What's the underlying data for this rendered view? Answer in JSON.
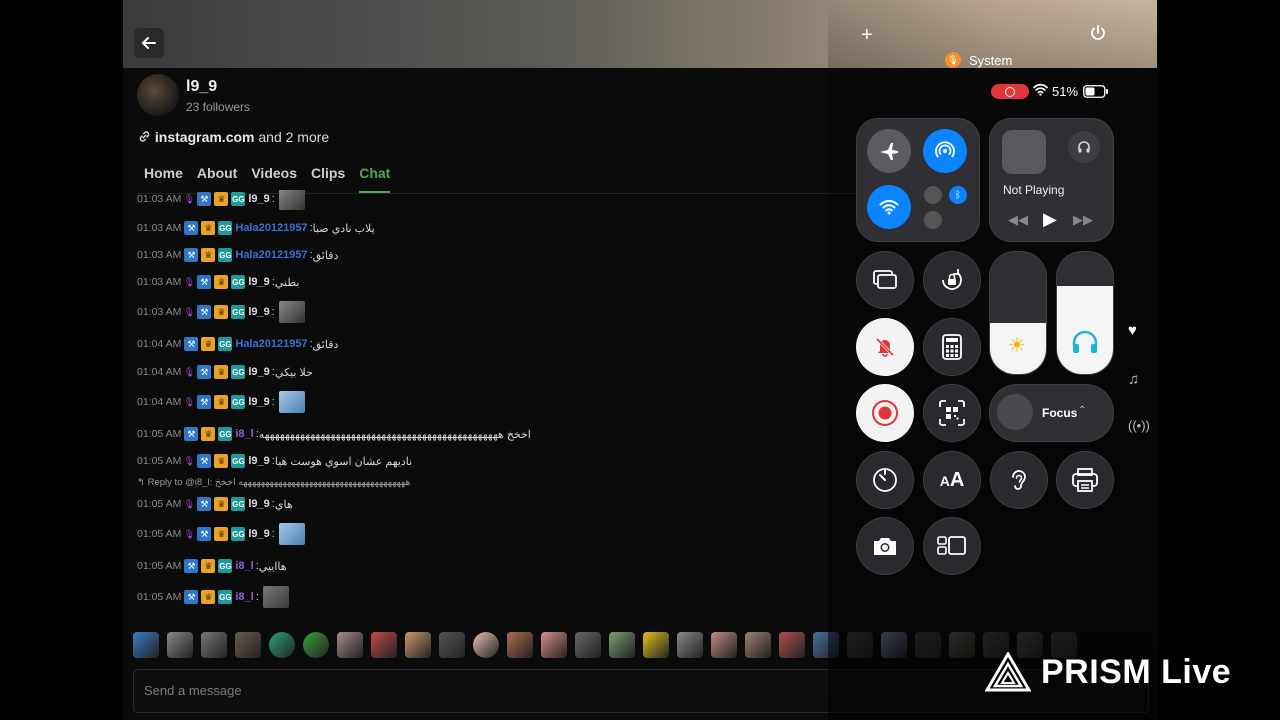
{
  "profile": {
    "name": "l9_9",
    "followers": "23 followers",
    "link": "instagram.com",
    "link_more": "and 2 more"
  },
  "tabs": [
    "Home",
    "About",
    "Videos",
    "Clips",
    "Chat"
  ],
  "active_tab": "Chat",
  "chat": [
    {
      "time": "01:03 AM",
      "mic": true,
      "user": "l9_9",
      "color": "white",
      "text": "",
      "thumb": "dark"
    },
    {
      "time": "01:03 AM",
      "mic": false,
      "user": "Hala20121957",
      "color": "blue",
      "text": "يلاب نادي صبا"
    },
    {
      "time": "01:03 AM",
      "mic": false,
      "user": "Hala20121957",
      "color": "blue",
      "text": "دقائق"
    },
    {
      "time": "01:03 AM",
      "mic": true,
      "user": "l9_9",
      "color": "white",
      "text": "بطني"
    },
    {
      "time": "01:03 AM",
      "mic": true,
      "user": "l9_9",
      "color": "white",
      "text": "",
      "thumb": "dark"
    },
    {
      "time": "01:04 AM",
      "mic": false,
      "user": "Hala20121957",
      "color": "blue",
      "text": "دقائق"
    },
    {
      "time": "01:04 AM",
      "mic": true,
      "user": "l9_9",
      "color": "white",
      "text": "حلا بيكي"
    },
    {
      "time": "01:04 AM",
      "mic": true,
      "user": "l9_9",
      "color": "white",
      "text": "",
      "thumb": "blue"
    },
    {
      "time": "01:05 AM",
      "mic": false,
      "user": "i8_l",
      "color": "purple",
      "text": "اخخخ هههههههههههههههههههههههههههههههههههههههههههههههه"
    },
    {
      "time": "01:05 AM",
      "mic": true,
      "user": "l9_9",
      "color": "white",
      "text": "ناديهم عشان اسوي هوست هيا"
    },
    {
      "time": "01:05 AM",
      "mic": true,
      "user": "l9_9",
      "color": "white",
      "text": "هاي",
      "reply": "Reply to @i8_l: ههههههههههههههههههههههههههههههههههههههه اخخخ"
    },
    {
      "time": "01:05 AM",
      "mic": true,
      "user": "l9_9",
      "color": "white",
      "text": "",
      "thumb": "blue"
    },
    {
      "time": "01:05 AM",
      "mic": false,
      "user": "i8_l",
      "color": "purple",
      "text": "هااييي"
    },
    {
      "time": "01:05 AM",
      "mic": false,
      "user": "i8_l",
      "color": "purple",
      "text": "",
      "thumb": "cat"
    }
  ],
  "message_placeholder": "Send a message",
  "control_center": {
    "source_label": "System",
    "battery": "51%",
    "now_playing": "Not Playing",
    "focus_label": "Focus",
    "brightness_level": 0.42,
    "volume_level": 0.72
  },
  "watermark": "PRISM Live",
  "colors": {
    "accent_green": "#53a653",
    "cc_blue": "#0a84ff",
    "record_red": "#e0353b",
    "system_orange": "#f0932b"
  }
}
